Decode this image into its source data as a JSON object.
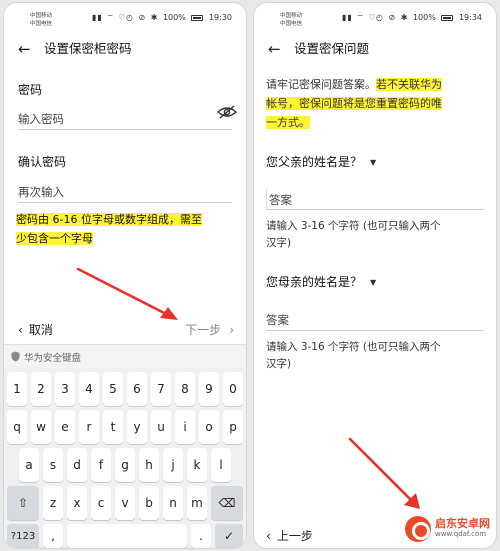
{
  "left_screen": {
    "status": {
      "carrier_1": "中国移动",
      "carrier_2": "中国电信",
      "battery": "100%",
      "time": "19:30"
    },
    "header": {
      "back_icon": "back-arrow-icon",
      "title": "设置保密柜密码"
    },
    "password": {
      "label": "密码",
      "placeholder": "输入密码",
      "visibility_icon": "eye-icon"
    },
    "confirm": {
      "label": "确认密码",
      "placeholder": "再次输入"
    },
    "hint_line1": "密码由 6-16 位字母或数字组成，需至",
    "hint_line2": "少包含一个字母",
    "hint_color": "#fff33a",
    "footer": {
      "cancel": "取消",
      "next": "下一步"
    },
    "keyboard": {
      "bar_label": "华为安全键盘",
      "row1": [
        "1",
        "2",
        "3",
        "4",
        "5",
        "6",
        "7",
        "8",
        "9",
        "0"
      ],
      "row2": [
        "q",
        "w",
        "e",
        "r",
        "t",
        "y",
        "u",
        "i",
        "o",
        "p"
      ],
      "row3": [
        "a",
        "s",
        "d",
        "f",
        "g",
        "h",
        "j",
        "k",
        "l"
      ],
      "row4": [
        "z",
        "x",
        "c",
        "v",
        "b",
        "n",
        "m"
      ],
      "symbol_key": "?123",
      "comma_key": ",",
      "period_key": ".",
      "enter_icon": "check-icon",
      "shift_icon": "shift-icon",
      "delete_icon": "backspace-icon"
    },
    "annotation_arrow_color": "#e8322a"
  },
  "right_screen": {
    "status": {
      "carrier_1": "中国移动",
      "carrier_2": "中国电信",
      "battery": "100%",
      "time": "19:34"
    },
    "header": {
      "back_icon": "back-arrow-icon",
      "title": "设置密保问题"
    },
    "intro_plain": "请牢记密保问题答案。",
    "intro_highlight_1": "若不关联华为",
    "intro_highlight_2": "帐号，密保问题将是您重置密码的唯",
    "intro_highlight_3": "一方式。",
    "q1": {
      "label": "您父亲的姓名是？",
      "placeholder": "答案",
      "helper_1": "请输入 3-16 个字符 (也可只输入两个",
      "helper_2": "汉字)"
    },
    "q2": {
      "label": "您母亲的姓名是？",
      "placeholder": "答案",
      "helper_1": "请输入 3-16 个字符 (也可只输入两个",
      "helper_2": "汉字)"
    },
    "footer": {
      "prev": "上一步"
    },
    "watermark": {
      "title": "启东安卓网",
      "url": "www.qdaf.com"
    }
  }
}
